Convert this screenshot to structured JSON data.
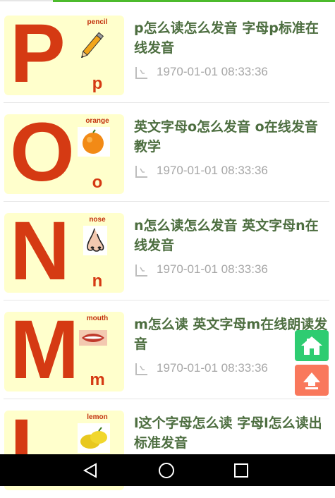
{
  "accent_color": "#4cbb2c",
  "letter_color": "#d53a13",
  "title_color": "#4d6e40",
  "articles": [
    {
      "title": "p怎么读怎么发音 字母p标准在线发音",
      "date": "1970-01-01 08:33:36",
      "thumb": {
        "big_letter": "P",
        "small_letter": "p",
        "word": "pencil",
        "picture": "pencil-icon"
      }
    },
    {
      "title": "英文字母o怎么发音 o在线发音教学",
      "date": "1970-01-01 08:33:36",
      "thumb": {
        "big_letter": "O",
        "small_letter": "o",
        "word": "orange",
        "picture": "orange-icon"
      }
    },
    {
      "title": "n怎么读怎么发音 英文字母n在线发音",
      "date": "1970-01-01 08:33:36",
      "thumb": {
        "big_letter": "N",
        "small_letter": "n",
        "word": "nose",
        "picture": "nose-icon"
      }
    },
    {
      "title": "m怎么读 英文字母m在线朗读发音",
      "date": "1970-01-01 08:33:36",
      "thumb": {
        "big_letter": "M",
        "small_letter": "m",
        "word": "mouth",
        "picture": "mouth-icon"
      }
    },
    {
      "title": "l这个字母怎么读 字母l怎么读出标准发音",
      "date": "",
      "thumb": {
        "big_letter": "L",
        "small_letter": "",
        "word": "lemon",
        "picture": "lemon-icon"
      }
    }
  ],
  "floating_buttons": {
    "home": "home-icon",
    "top": "arrow-up-icon"
  },
  "system_nav": {
    "back": "back-triangle-icon",
    "home": "home-circle-icon",
    "recents": "recents-square-icon"
  }
}
